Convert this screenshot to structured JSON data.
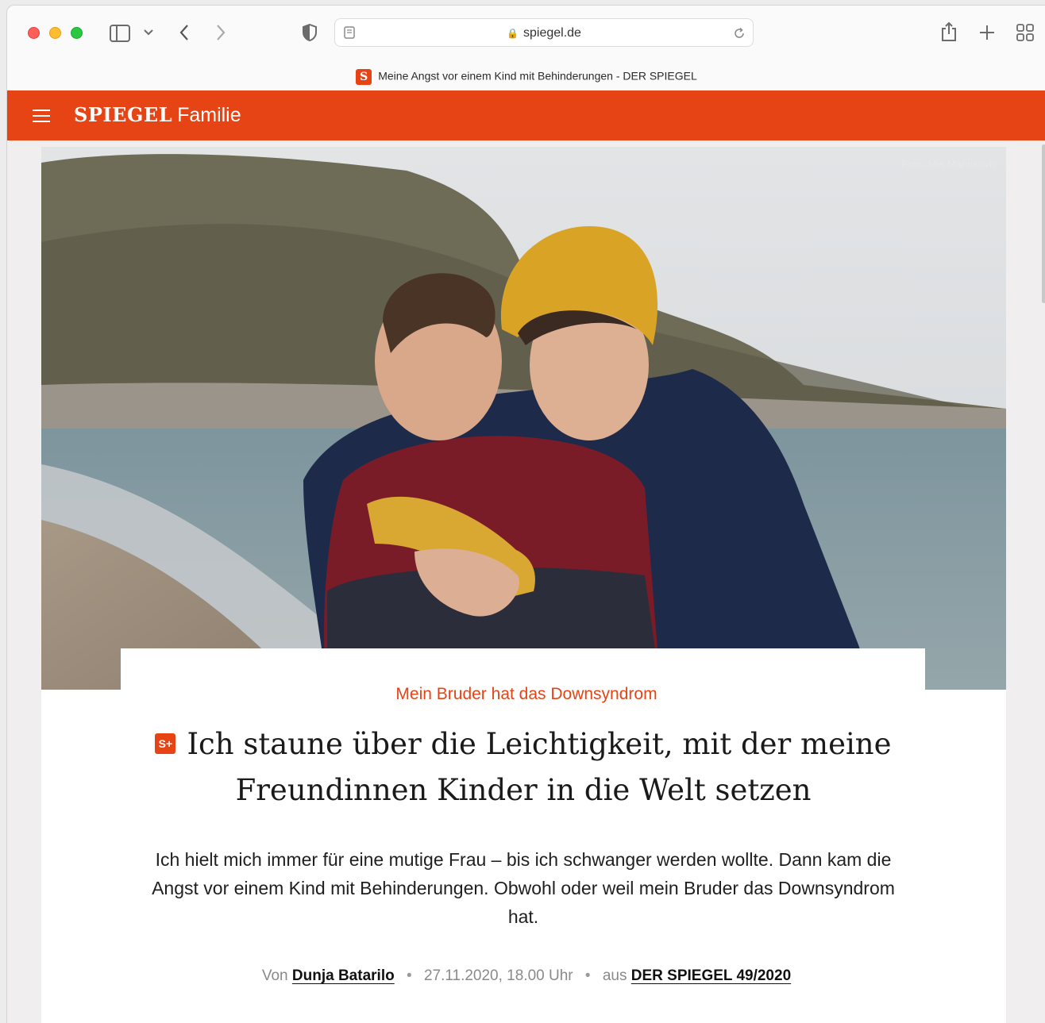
{
  "browser": {
    "address": "spiegel.de",
    "tab_title": "Meine Angst vor einem Kind mit Behinderungen - DER SPIEGEL",
    "favicon_letter": "S"
  },
  "site": {
    "logo": "SPIEGEL",
    "section": "Familie",
    "brand_color": "#e64415"
  },
  "article": {
    "photo_credit": "Foto: Mia Marinkovic",
    "kicker": "Mein Bruder hat das Downsyndrom",
    "plus_badge": "S+",
    "headline": "Ich staune über die Leichtigkeit, mit der meine Freundinnen Kinder in die Welt setzen",
    "lead": "Ich hielt mich immer für eine mutige Frau – bis ich schwanger werden wollte. Dann kam die Angst vor einem Kind mit Behinderungen. Obwohl oder weil mein Bruder das Downsyndrom hat.",
    "byline": {
      "von_label": "Von",
      "author": "Dunja Batarilo",
      "date": "27.11.2020, 18.00 Uhr",
      "aus_label": "aus",
      "issue": "DER SPIEGEL 49/2020",
      "separator": "•"
    }
  }
}
